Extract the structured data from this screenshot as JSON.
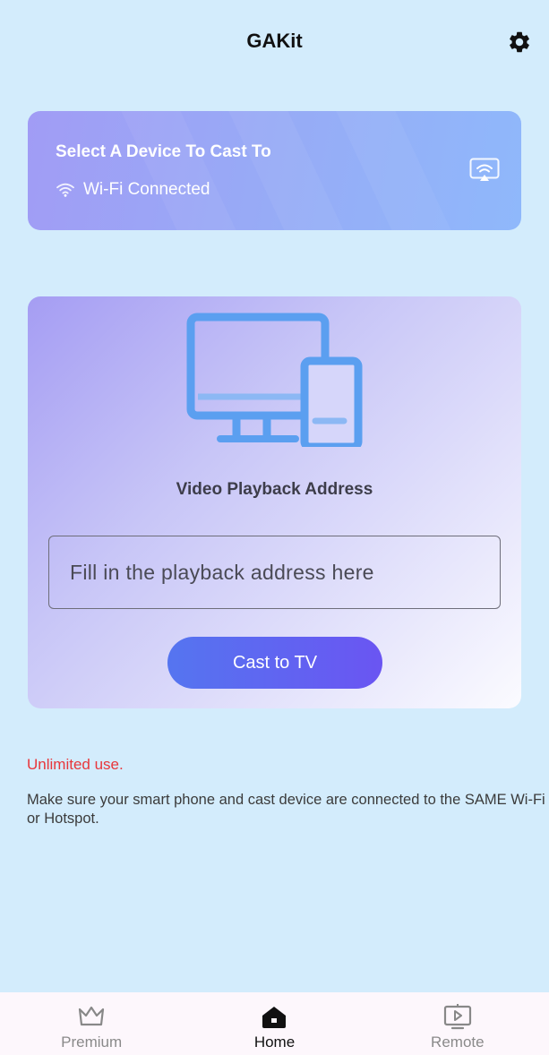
{
  "header": {
    "title": "GAKit",
    "settings_icon": "gear-icon"
  },
  "device_card": {
    "title": "Select A Device To Cast To",
    "wifi_status": "Wi-Fi Connected",
    "wifi_icon": "wifi-icon",
    "cast_icon": "screen-cast-icon"
  },
  "playback": {
    "illustration": "monitor-and-phone-illustration",
    "label": "Video Playback Address",
    "input_value": "",
    "input_placeholder": "Fill in the playback address here",
    "cast_button": "Cast to TV"
  },
  "info": {
    "unlimited": "Unlimited use.",
    "notice": "Make sure your smart phone and cast device are connected to the SAME Wi-Fi or Hotspot."
  },
  "nav": {
    "items": [
      {
        "label": "Premium",
        "icon": "crown-icon",
        "active": false
      },
      {
        "label": "Home",
        "icon": "home-icon",
        "active": true
      },
      {
        "label": "Remote",
        "icon": "remote-screen-icon",
        "active": false
      }
    ]
  },
  "colors": {
    "background": "#d3ecfc",
    "accent": "#5f63f1",
    "warning": "#e8373b",
    "illustration": "#5b9ff0"
  }
}
